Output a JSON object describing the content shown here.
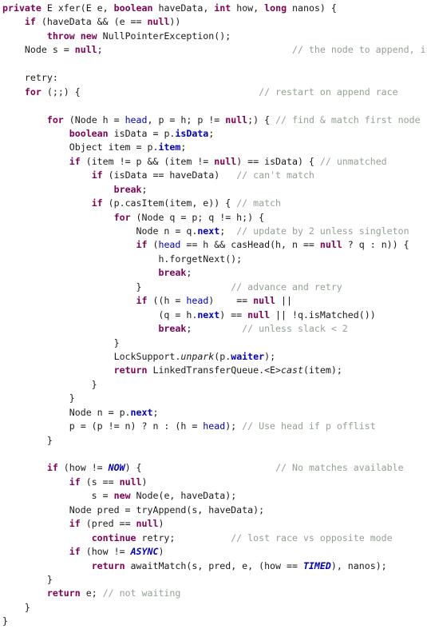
{
  "editor": {
    "language": "Java",
    "theme": "eclipse-light",
    "colors": {
      "background": "#ffffff",
      "foreground": "#1a1a1a",
      "keyword": "#7f0055",
      "comment": "#93a193",
      "field": "#0000c0",
      "static_field": "#0000c0"
    },
    "method_signature": "private E xfer(E e, boolean haveData, int how, long nanos)"
  },
  "code": {
    "lines": [
      [
        {
          "t": "kw",
          "s": "private"
        },
        {
          "t": "pl",
          "s": " E xfer(E e, "
        },
        {
          "t": "kw",
          "s": "boolean"
        },
        {
          "t": "pl",
          "s": " haveData, "
        },
        {
          "t": "kw",
          "s": "int"
        },
        {
          "t": "pl",
          "s": " how, "
        },
        {
          "t": "kw",
          "s": "long"
        },
        {
          "t": "pl",
          "s": " nanos) {"
        }
      ],
      [
        {
          "t": "pl",
          "s": "    "
        },
        {
          "t": "kw",
          "s": "if"
        },
        {
          "t": "pl",
          "s": " (haveData && (e == "
        },
        {
          "t": "kw",
          "s": "null"
        },
        {
          "t": "pl",
          "s": "))"
        }
      ],
      [
        {
          "t": "pl",
          "s": "        "
        },
        {
          "t": "kw",
          "s": "throw new"
        },
        {
          "t": "pl",
          "s": " NullPointerException();"
        }
      ],
      [
        {
          "t": "pl",
          "s": "    Node s = "
        },
        {
          "t": "kw",
          "s": "null"
        },
        {
          "t": "pl",
          "s": ";                                  "
        },
        {
          "t": "cm",
          "s": "// the node to append, if needed"
        }
      ],
      [],
      [
        {
          "t": "pl",
          "s": "    retry:"
        }
      ],
      [
        {
          "t": "pl",
          "s": "    "
        },
        {
          "t": "kw",
          "s": "for"
        },
        {
          "t": "pl",
          "s": " (;;) {                                "
        },
        {
          "t": "cm",
          "s": "// restart on append race"
        }
      ],
      [],
      [
        {
          "t": "pl",
          "s": "        "
        },
        {
          "t": "kw",
          "s": "for"
        },
        {
          "t": "pl",
          "s": " (Node h = "
        },
        {
          "t": "fldp",
          "s": "head"
        },
        {
          "t": "pl",
          "s": ", p = h; p != "
        },
        {
          "t": "kw",
          "s": "null"
        },
        {
          "t": "pl",
          "s": ";) { "
        },
        {
          "t": "cm",
          "s": "// find & match first node"
        }
      ],
      [
        {
          "t": "pl",
          "s": "            "
        },
        {
          "t": "kw",
          "s": "boolean"
        },
        {
          "t": "pl",
          "s": " isData = p."
        },
        {
          "t": "fld",
          "s": "isData"
        },
        {
          "t": "pl",
          "s": ";"
        }
      ],
      [
        {
          "t": "pl",
          "s": "            Object item = p."
        },
        {
          "t": "fld",
          "s": "item"
        },
        {
          "t": "pl",
          "s": ";"
        }
      ],
      [
        {
          "t": "pl",
          "s": "            "
        },
        {
          "t": "kw",
          "s": "if"
        },
        {
          "t": "pl",
          "s": " (item != p && (item != "
        },
        {
          "t": "kw",
          "s": "null"
        },
        {
          "t": "pl",
          "s": ") == isData) { "
        },
        {
          "t": "cm",
          "s": "// unmatched"
        }
      ],
      [
        {
          "t": "pl",
          "s": "                "
        },
        {
          "t": "kw",
          "s": "if"
        },
        {
          "t": "pl",
          "s": " (isData == haveData)   "
        },
        {
          "t": "cm",
          "s": "// can't match"
        }
      ],
      [
        {
          "t": "pl",
          "s": "                    "
        },
        {
          "t": "kw",
          "s": "break"
        },
        {
          "t": "pl",
          "s": ";"
        }
      ],
      [
        {
          "t": "pl",
          "s": "                "
        },
        {
          "t": "kw",
          "s": "if"
        },
        {
          "t": "pl",
          "s": " (p.casItem(item, e)) { "
        },
        {
          "t": "cm",
          "s": "// match"
        }
      ],
      [
        {
          "t": "pl",
          "s": "                    "
        },
        {
          "t": "kw",
          "s": "for"
        },
        {
          "t": "pl",
          "s": " (Node q = p; q != h;) {"
        }
      ],
      [
        {
          "t": "pl",
          "s": "                        Node n = q."
        },
        {
          "t": "fld",
          "s": "next"
        },
        {
          "t": "pl",
          "s": ";  "
        },
        {
          "t": "cm",
          "s": "// update by 2 unless singleton"
        }
      ],
      [
        {
          "t": "pl",
          "s": "                        "
        },
        {
          "t": "kw",
          "s": "if"
        },
        {
          "t": "pl",
          "s": " ("
        },
        {
          "t": "fldp",
          "s": "head"
        },
        {
          "t": "pl",
          "s": " == h && casHead(h, n == "
        },
        {
          "t": "kw",
          "s": "null"
        },
        {
          "t": "pl",
          "s": " ? q : n)) {"
        }
      ],
      [
        {
          "t": "pl",
          "s": "                            h.forgetNext();"
        }
      ],
      [
        {
          "t": "pl",
          "s": "                            "
        },
        {
          "t": "kw",
          "s": "break"
        },
        {
          "t": "pl",
          "s": ";"
        }
      ],
      [
        {
          "t": "pl",
          "s": "                        }                "
        },
        {
          "t": "cm",
          "s": "// advance and retry"
        }
      ],
      [
        {
          "t": "pl",
          "s": "                        "
        },
        {
          "t": "kw",
          "s": "if"
        },
        {
          "t": "pl",
          "s": " ((h = "
        },
        {
          "t": "fldp",
          "s": "head"
        },
        {
          "t": "pl",
          "s": ")    == "
        },
        {
          "t": "kw",
          "s": "null"
        },
        {
          "t": "pl",
          "s": " ||"
        }
      ],
      [
        {
          "t": "pl",
          "s": "                            (q = h."
        },
        {
          "t": "fld",
          "s": "next"
        },
        {
          "t": "pl",
          "s": ") == "
        },
        {
          "t": "kw",
          "s": "null"
        },
        {
          "t": "pl",
          "s": " || !q.isMatched())"
        }
      ],
      [
        {
          "t": "pl",
          "s": "                            "
        },
        {
          "t": "kw",
          "s": "break"
        },
        {
          "t": "pl",
          "s": ";         "
        },
        {
          "t": "cm",
          "s": "// unless slack < 2"
        }
      ],
      [
        {
          "t": "pl",
          "s": "                    }"
        }
      ],
      [
        {
          "t": "pl",
          "s": "                    LockSupport."
        },
        {
          "t": "stm",
          "s": "unpark"
        },
        {
          "t": "pl",
          "s": "(p."
        },
        {
          "t": "fld",
          "s": "waiter"
        },
        {
          "t": "pl",
          "s": ");"
        }
      ],
      [
        {
          "t": "pl",
          "s": "                    "
        },
        {
          "t": "kw",
          "s": "return"
        },
        {
          "t": "pl",
          "s": " LinkedTransferQueue.<E>"
        },
        {
          "t": "stm",
          "s": "cast"
        },
        {
          "t": "pl",
          "s": "(item);"
        }
      ],
      [
        {
          "t": "pl",
          "s": "                }"
        }
      ],
      [
        {
          "t": "pl",
          "s": "            }"
        }
      ],
      [
        {
          "t": "pl",
          "s": "            Node n = p."
        },
        {
          "t": "fld",
          "s": "next"
        },
        {
          "t": "pl",
          "s": ";"
        }
      ],
      [
        {
          "t": "pl",
          "s": "            p = (p != n) ? n : (h = "
        },
        {
          "t": "fldp",
          "s": "head"
        },
        {
          "t": "pl",
          "s": "); "
        },
        {
          "t": "cm",
          "s": "// Use head if p offlist"
        }
      ],
      [
        {
          "t": "pl",
          "s": "        }"
        }
      ],
      [],
      [
        {
          "t": "pl",
          "s": "        "
        },
        {
          "t": "kw",
          "s": "if"
        },
        {
          "t": "pl",
          "s": " (how != "
        },
        {
          "t": "sfld",
          "s": "NOW"
        },
        {
          "t": "pl",
          "s": ") {                        "
        },
        {
          "t": "cm",
          "s": "// No matches available"
        }
      ],
      [
        {
          "t": "pl",
          "s": "            "
        },
        {
          "t": "kw",
          "s": "if"
        },
        {
          "t": "pl",
          "s": " (s == "
        },
        {
          "t": "kw",
          "s": "null"
        },
        {
          "t": "pl",
          "s": ")"
        }
      ],
      [
        {
          "t": "pl",
          "s": "                s = "
        },
        {
          "t": "kw",
          "s": "new"
        },
        {
          "t": "pl",
          "s": " Node(e, haveData);"
        }
      ],
      [
        {
          "t": "pl",
          "s": "            Node pred = tryAppend(s, haveData);"
        }
      ],
      [
        {
          "t": "pl",
          "s": "            "
        },
        {
          "t": "kw",
          "s": "if"
        },
        {
          "t": "pl",
          "s": " (pred == "
        },
        {
          "t": "kw",
          "s": "null"
        },
        {
          "t": "pl",
          "s": ")"
        }
      ],
      [
        {
          "t": "pl",
          "s": "                "
        },
        {
          "t": "kw",
          "s": "continue"
        },
        {
          "t": "pl",
          "s": " retry;          "
        },
        {
          "t": "cm",
          "s": "// lost race vs opposite mode"
        }
      ],
      [
        {
          "t": "pl",
          "s": "            "
        },
        {
          "t": "kw",
          "s": "if"
        },
        {
          "t": "pl",
          "s": " (how != "
        },
        {
          "t": "sfld",
          "s": "ASYNC"
        },
        {
          "t": "pl",
          "s": ")"
        }
      ],
      [
        {
          "t": "pl",
          "s": "                "
        },
        {
          "t": "kw",
          "s": "return"
        },
        {
          "t": "pl",
          "s": " awaitMatch(s, pred, e, (how == "
        },
        {
          "t": "sfld",
          "s": "TIMED"
        },
        {
          "t": "pl",
          "s": "), nanos);"
        }
      ],
      [
        {
          "t": "pl",
          "s": "        }"
        }
      ],
      [
        {
          "t": "pl",
          "s": "        "
        },
        {
          "t": "kw",
          "s": "return"
        },
        {
          "t": "pl",
          "s": " e; "
        },
        {
          "t": "cm",
          "s": "// not waiting"
        }
      ],
      [
        {
          "t": "pl",
          "s": "    }"
        }
      ],
      [
        {
          "t": "pl",
          "s": "}"
        }
      ]
    ]
  }
}
